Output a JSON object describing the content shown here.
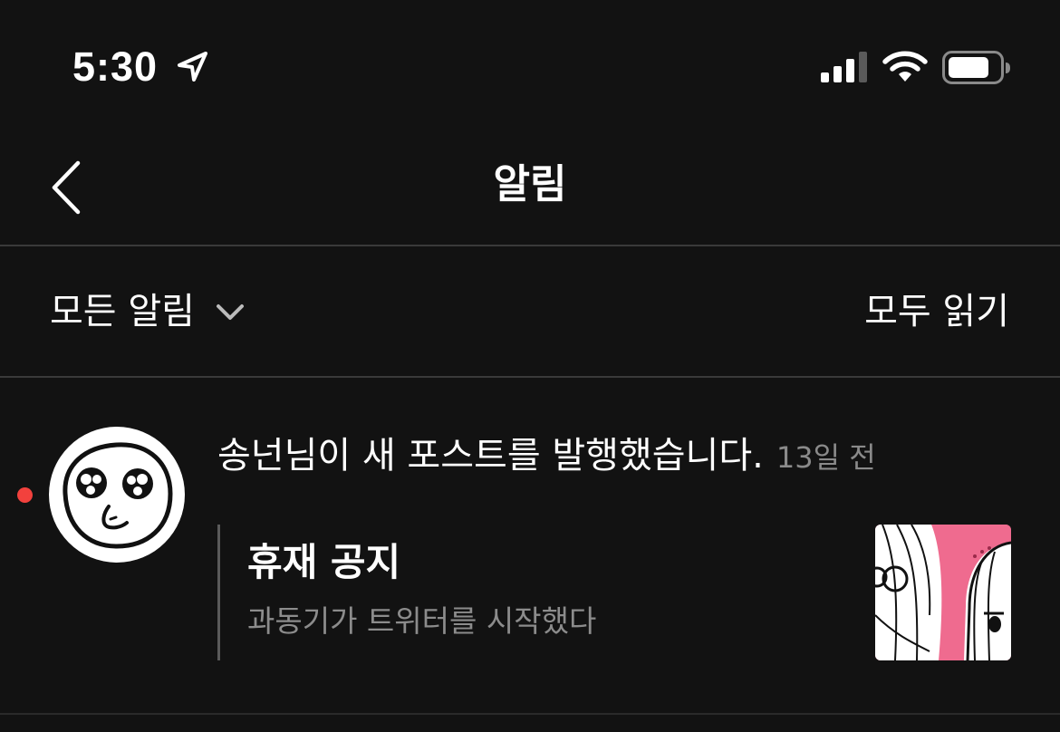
{
  "status_bar": {
    "time": "5:30",
    "icons": [
      "location-arrow-icon",
      "cellular-signal-icon",
      "wifi-icon",
      "battery-icon"
    ]
  },
  "header": {
    "back_icon": "chevron-left-icon",
    "title": "알림"
  },
  "filter": {
    "selected": "모든 알림",
    "dropdown_icon": "chevron-down-icon",
    "mark_all_read": "모두 읽기"
  },
  "notifications": [
    {
      "unread": true,
      "message": "송넌님이 새 포스트를 발행했습니다.",
      "time": "13일 전",
      "post_title": "휴재 공지",
      "post_subtitle": "과동기가 트위터를 시작했다"
    }
  ],
  "colors": {
    "background": "#121212",
    "divider": "#3a3a3a",
    "unread_dot": "#f2413d",
    "muted_text": "#8a8a8a",
    "thumbnail_pink": "#ef6b8f"
  }
}
